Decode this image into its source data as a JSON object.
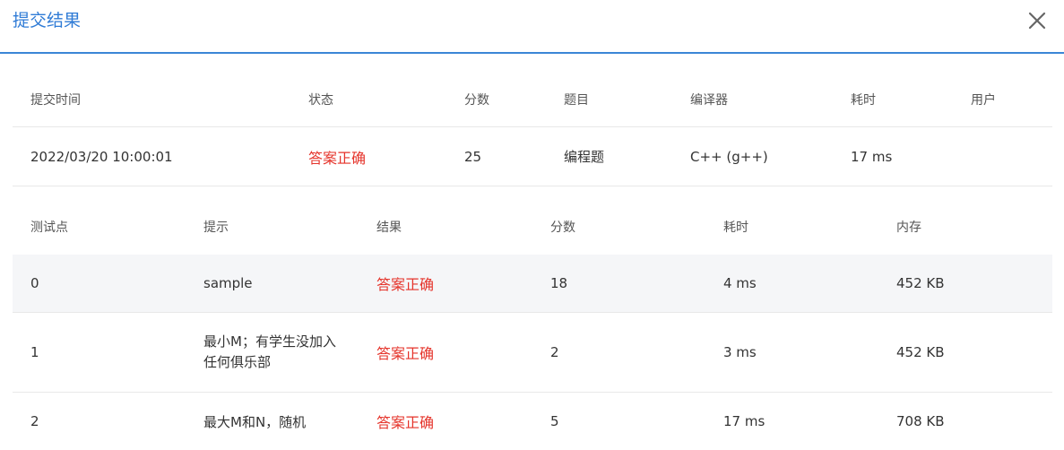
{
  "dialog": {
    "title": "提交结果",
    "close_icon": "close-icon"
  },
  "summary": {
    "headers": {
      "time": "提交时间",
      "status": "状态",
      "score": "分数",
      "problem": "题目",
      "compiler": "编译器",
      "elapsed": "耗时",
      "user": "用户"
    },
    "row": {
      "time": "2022/03/20 10:00:01",
      "status": "答案正确",
      "score": "25",
      "problem": "编程题",
      "compiler": "C++ (g++)",
      "elapsed": "17 ms",
      "user": ""
    }
  },
  "cases": {
    "headers": {
      "id": "测试点",
      "hint": "提示",
      "result": "结果",
      "score": "分数",
      "time": "耗时",
      "memory": "内存"
    },
    "rows": [
      {
        "id": "0",
        "hint": "sample",
        "result": "答案正确",
        "score": "18",
        "time": "4 ms",
        "memory": "452 KB"
      },
      {
        "id": "1",
        "hint": "最小M；有学生没加入任何俱乐部",
        "result": "答案正确",
        "score": "2",
        "time": "3 ms",
        "memory": "452 KB"
      },
      {
        "id": "2",
        "hint": "最大M和N，随机",
        "result": "答案正确",
        "score": "5",
        "time": "17 ms",
        "memory": "708 KB"
      }
    ]
  },
  "colors": {
    "accent": "#2f7bd6",
    "accepted": "#e5332a",
    "row_highlight": "#f5f6f8"
  }
}
